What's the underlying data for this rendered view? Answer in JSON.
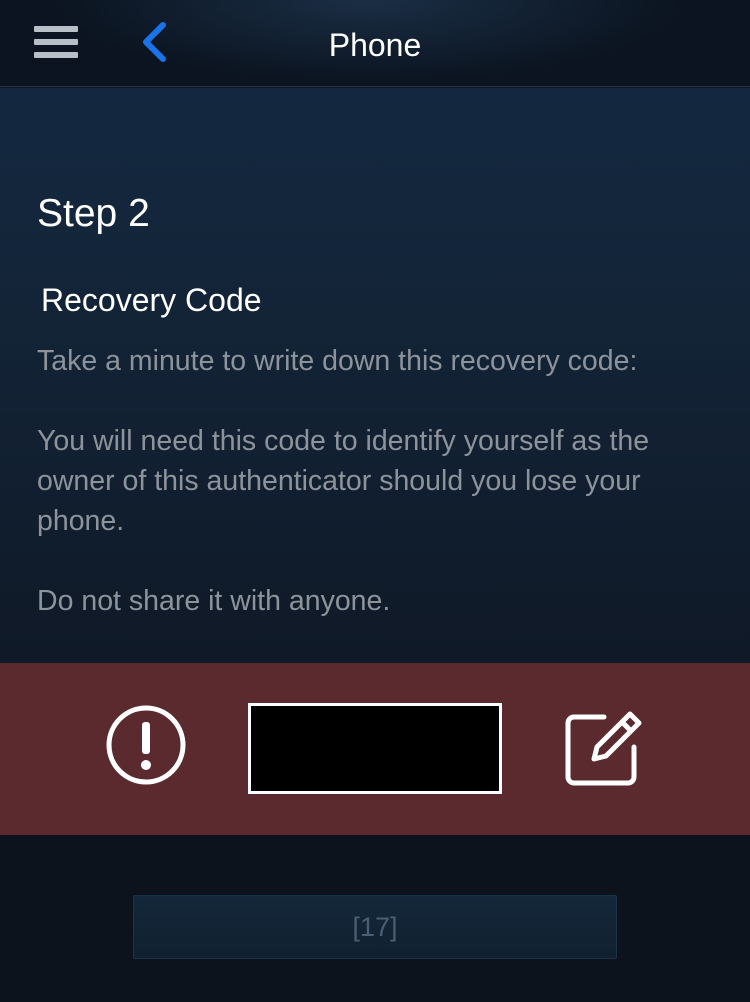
{
  "header": {
    "title": "Phone",
    "menu_icon": "hamburger-menu-icon",
    "back_icon": "chevron-left-icon"
  },
  "step": {
    "title": "Step 2",
    "section_title": "Recovery Code",
    "paragraphs": [
      "Take a minute to write down this recovery code:",
      "You will need this code to identify yourself as the owner of this authenticator should you lose your phone.",
      "Do not share it with anyone."
    ]
  },
  "recovery": {
    "warning_icon": "exclamation-circle-icon",
    "code": "",
    "edit_icon": "edit-note-icon"
  },
  "footer": {
    "button_label": "[17]"
  },
  "colors": {
    "accent_blue": "#1a73e8",
    "warning_band": "#5b2a2f",
    "body_text": "#8d939b"
  }
}
